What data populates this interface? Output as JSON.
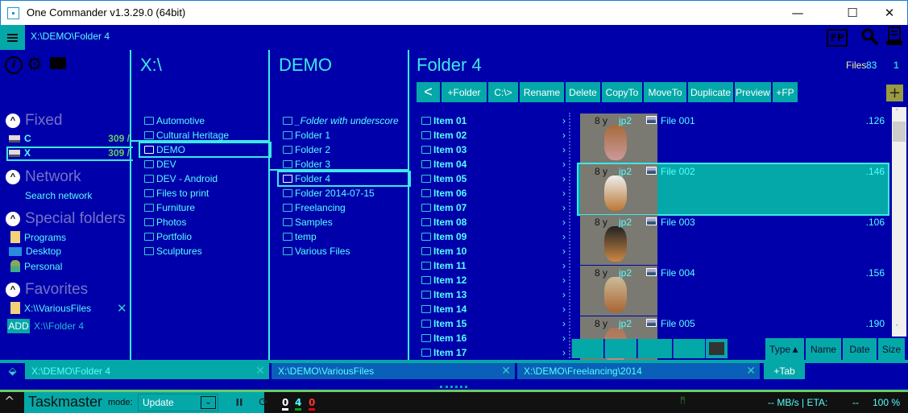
{
  "window": {
    "title": "One Commander v1.3.29.0 (64bit)",
    "minimize": "—",
    "maximize": "☐",
    "close": "✕"
  },
  "pathbar": {
    "path": "X:\\DEMO\\Folder 4"
  },
  "top_icons": {
    "fp": "FP",
    "search": "🔍",
    "panel": "▤"
  },
  "sidebar": {
    "fixed": {
      "label": "Fixed",
      "drives": [
        {
          "name": "C",
          "free": "309 /"
        },
        {
          "name": "X",
          "free": "309 /"
        }
      ]
    },
    "network": {
      "label": "Network",
      "items": [
        "Search network"
      ]
    },
    "special": {
      "label": "Special folders",
      "items": [
        "Programs",
        "Desktop",
        "Personal"
      ]
    },
    "favorites": {
      "label": "Favorites",
      "items": [
        "X:\\\\VariousFiles"
      ],
      "add_label": "ADD",
      "add_path": "X:\\\\Folder 4"
    }
  },
  "col1": {
    "title": "X:\\",
    "items": [
      "Automotive",
      "Cultural Heritage",
      "DEMO",
      "DEV",
      "DEV - Android",
      "Files to print",
      "Furniture",
      "Photos",
      "Portfolio",
      "Sculptures"
    ]
  },
  "col2": {
    "title": "DEMO",
    "items": [
      "_Folder with underscore",
      "Folder 1",
      "Folder 2",
      "Folder 3",
      "Folder 4",
      "Folder 2014-07-15",
      "Freelancing",
      "Samples",
      "temp",
      "Various Files"
    ]
  },
  "col3": {
    "title": "Folder 4",
    "files_label": "Files",
    "files_count": "83",
    "selected_count": "1",
    "toolbar": [
      "+Folder",
      "C:\\>",
      "Rename",
      "Delete",
      "CopyTo",
      "MoveTo",
      "Duplicate",
      "Preview",
      "+FP"
    ],
    "back": "<",
    "add": "+",
    "items": [
      "Item 01",
      "Item 02",
      "Item 03",
      "Item 04",
      "Item 05",
      "Item 06",
      "Item 07",
      "Item 08",
      "Item 09",
      "Item 10",
      "Item 11",
      "Item 12",
      "Item 13",
      "Item 14",
      "Item 15",
      "Item 16",
      "Item 17"
    ],
    "files": [
      {
        "age": "8 y",
        "ext": "jp2",
        "name": "File 001",
        "size": ".126"
      },
      {
        "age": "8 y",
        "ext": "jp2",
        "name": "File 002",
        "size": ".146"
      },
      {
        "age": "8 y",
        "ext": "jp2",
        "name": "File 003",
        "size": ".106"
      },
      {
        "age": "8 y",
        "ext": "jp2",
        "name": "File 004",
        "size": ".156"
      },
      {
        "age": "8 y",
        "ext": "jp2",
        "name": "File 005",
        "size": ".190"
      }
    ],
    "sort": [
      "Type▲",
      "Name",
      "Date",
      "Size"
    ]
  },
  "tabs": [
    {
      "path": "X:\\DEMO\\Folder 4"
    },
    {
      "path": "X:\\DEMO\\VariousFiles"
    },
    {
      "path": "X:\\DEMO\\Freelancing\\2014"
    }
  ],
  "add_tab": "+Tab",
  "taskmaster": {
    "title": "Taskmaster",
    "mode_label": "mode:",
    "mode_value": "Update",
    "counts": [
      "0",
      "4",
      "0"
    ],
    "speed": "-- MB/s | ETA:",
    "eta": "--",
    "percent": "100 %"
  }
}
